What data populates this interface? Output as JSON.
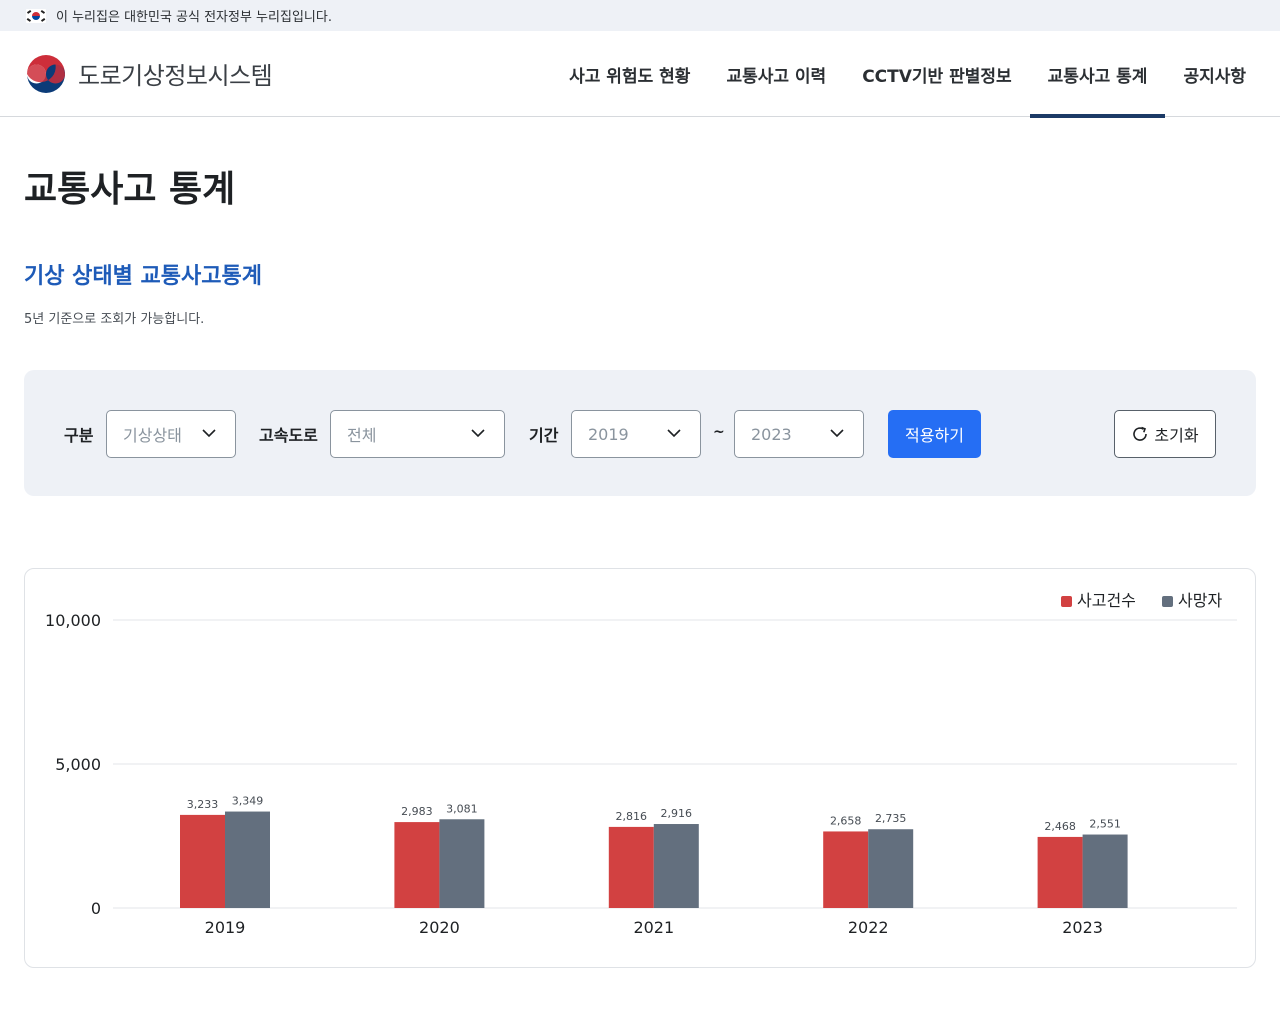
{
  "gov_banner": {
    "text": "이 누리집은 대한민국 공식 전자정부 누리집입니다."
  },
  "header": {
    "site_title": "도로기상정보시스템",
    "nav": [
      {
        "label": "사고 위험도 현황",
        "active": false
      },
      {
        "label": "교통사고 이력",
        "active": false
      },
      {
        "label": "CCTV기반 판별정보",
        "active": false
      },
      {
        "label": "교통사고 통계",
        "active": true
      },
      {
        "label": "공지사항",
        "active": false
      }
    ]
  },
  "page": {
    "title": "교통사고 통계",
    "section_title": "기상 상태별 교통사고통계",
    "section_desc": "5년 기준으로 조회가 가능합니다."
  },
  "filter": {
    "category_label": "구분",
    "category_value": "기상상태",
    "highway_label": "고속도로",
    "highway_value": "전체",
    "period_label": "기간",
    "period_from": "2019",
    "period_sep": "~",
    "period_to": "2023",
    "apply_label": "적용하기",
    "reset_label": "초기화"
  },
  "colors": {
    "accident": "#d24141",
    "death": "#636f7e",
    "accent": "#256ef4",
    "nav_active": "#1c3a66"
  },
  "chart_data": {
    "type": "bar",
    "categories": [
      "2019",
      "2020",
      "2021",
      "2022",
      "2023"
    ],
    "series": [
      {
        "name": "사고건수",
        "values": [
          3233,
          2983,
          2816,
          2658,
          2468
        ]
      },
      {
        "name": "사망자",
        "values": [
          3349,
          3081,
          2916,
          2735,
          2551
        ]
      }
    ],
    "ylim": [
      0,
      10000
    ],
    "yticks": [
      0,
      5000,
      10000
    ],
    "ytick_labels": [
      "0",
      "5,000",
      "10,000"
    ],
    "legend_position": "top-right",
    "grid": true
  }
}
